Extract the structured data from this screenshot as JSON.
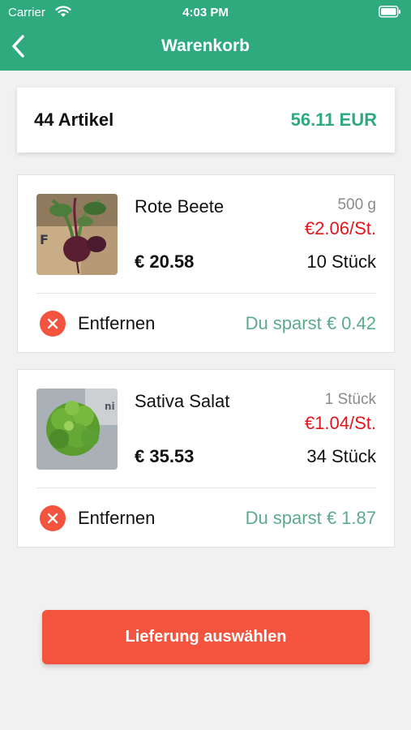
{
  "status_bar": {
    "carrier": "Carrier",
    "time": "4:03 PM"
  },
  "nav": {
    "title": "Warenkorb",
    "back_icon": "chevron-left-icon"
  },
  "summary": {
    "count": "44 Artikel",
    "total": "56.11 EUR"
  },
  "items": [
    {
      "name": "Rote Beete",
      "unit": "500 g",
      "unit_price": "€2.06/St.",
      "price": "€ 20.58",
      "quantity": "10 Stück",
      "remove_label": "Entfernen",
      "savings": "Du sparst € 0.42",
      "image_icon": "beetroot-image"
    },
    {
      "name": "Sativa Salat",
      "unit": "1 Stück",
      "unit_price": "€1.04/St.",
      "price": "€ 35.53",
      "quantity": "34 Stück",
      "remove_label": "Entfernen",
      "savings": "Du sparst € 1.87",
      "image_icon": "lettuce-image"
    }
  ],
  "cta": {
    "label": "Lieferung auswählen"
  },
  "colors": {
    "brand_green": "#2eaa7e",
    "accent_red": "#f4543d",
    "price_red": "#e3141b",
    "savings_green": "#5bab8b"
  }
}
